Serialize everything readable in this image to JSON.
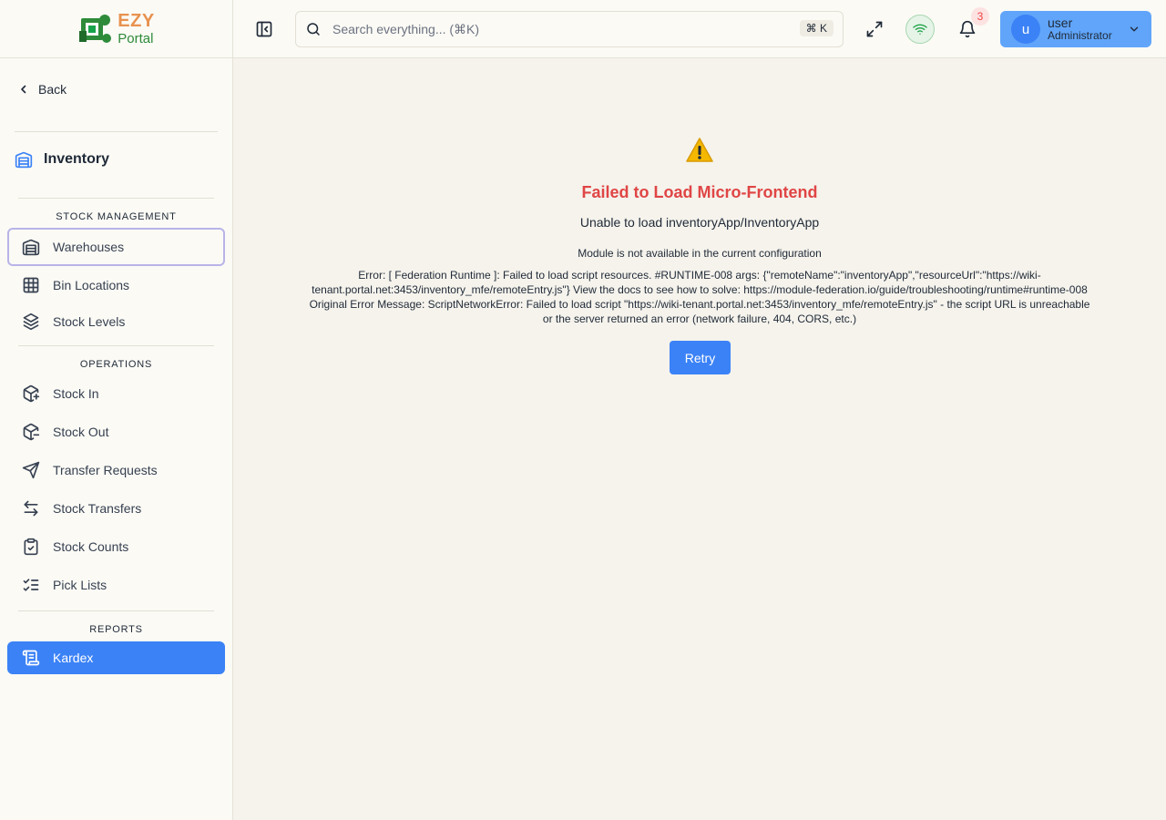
{
  "brand": {
    "line1": "EZY",
    "line2": "Portal"
  },
  "sidebar": {
    "back_label": "Back",
    "module_title": "Inventory",
    "sections": [
      {
        "label": "STOCK MANAGEMENT",
        "items": [
          {
            "label": "Warehouses",
            "icon": "warehouse-icon",
            "state": "focused"
          },
          {
            "label": "Bin Locations",
            "icon": "grid-icon"
          },
          {
            "label": "Stock Levels",
            "icon": "layers-icon"
          }
        ]
      },
      {
        "label": "OPERATIONS",
        "items": [
          {
            "label": "Stock In",
            "icon": "package-plus-icon"
          },
          {
            "label": "Stock Out",
            "icon": "package-minus-icon"
          },
          {
            "label": "Transfer Requests",
            "icon": "send-icon"
          },
          {
            "label": "Stock Transfers",
            "icon": "arrows-left-right-icon"
          },
          {
            "label": "Stock Counts",
            "icon": "clipboard-check-icon"
          },
          {
            "label": "Pick Lists",
            "icon": "list-checks-icon"
          }
        ]
      },
      {
        "label": "REPORTS",
        "items": [
          {
            "label": "Kardex",
            "icon": "scroll-icon",
            "state": "active"
          }
        ]
      }
    ]
  },
  "header": {
    "search_placeholder": "Search everything... (⌘K)",
    "search_shortcut": "⌘ K",
    "notification_count": "3",
    "user": {
      "initial": "u",
      "name": "user",
      "role": "Administrator"
    }
  },
  "error": {
    "title": "Failed to Load Micro-Frontend",
    "subtitle": "Unable to load inventoryApp/InventoryApp",
    "note": "Module is not available in the current configuration",
    "detail": "Error: [ Federation Runtime ]: Failed to load script resources. #RUNTIME-008 args: {\"remoteName\":\"inventoryApp\",\"resourceUrl\":\"https://wiki-tenant.portal.net:3453/inventory_mfe/remoteEntry.js\"} View the docs to see how to solve: https://module-federation.io/guide/troubleshooting/runtime#runtime-008 Original Error Message: ScriptNetworkError: Failed to load script \"https://wiki-tenant.portal.net:3453/inventory_mfe/remoteEntry.js\" - the script URL is unreachable or the server returned an error (network failure, 404, CORS, etc.)",
    "retry_label": "Retry"
  },
  "colors": {
    "accent": "#3b82f6",
    "error": "#e04545",
    "background": "#f5f3ec"
  }
}
